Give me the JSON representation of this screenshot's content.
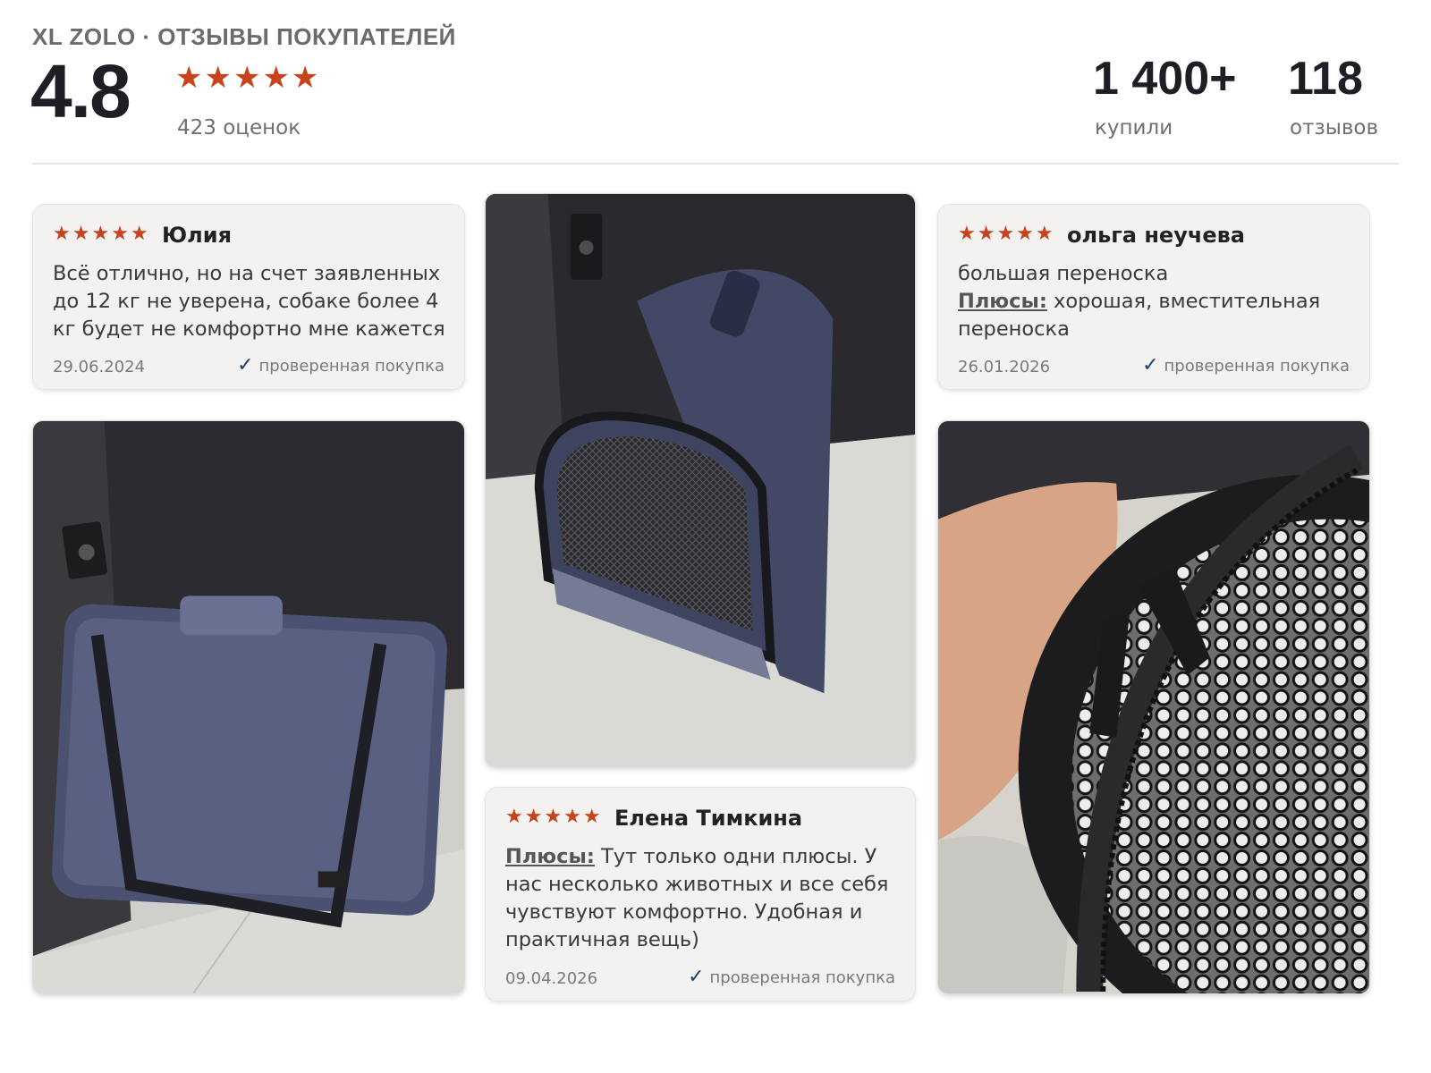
{
  "header": {
    "brand": "XL ZOLO · ОТЗЫВЫ ПОКУПАТЕЛЕЙ",
    "rating": "4.8",
    "stars": "★★★★★",
    "rating_count": "423 оценок",
    "bought_value": "1 400+",
    "bought_label": "купили",
    "reviews_value": "118",
    "reviews_label": "отзывов"
  },
  "reviews": [
    {
      "stars": "★★★★★",
      "author": "Юлия",
      "text": "Всё отлично, но на счет заявленных до 12 кг не уверена, собаке более 4 кг будет не комфортно мне кажется",
      "date": "29.06.2024",
      "verified": "проверенная покупка"
    },
    {
      "stars": "★★★★★",
      "author": "ольга неучева",
      "text": "большая переноска",
      "pros_label": "Плюсы:",
      "pros_text": "хорошая, вместительная переноска",
      "date": "26.01.2026",
      "verified": "проверенная покупка"
    },
    {
      "stars": "★★★★★",
      "author": "Елена Тимкина",
      "pros_label": "Плюсы:",
      "pros_text": "Тут только одни плюсы. У нас несколько животных и все себя чувствуют комфортно. Удобная и практичная вещь)",
      "date": "09.04.2026",
      "verified": "проверенная покупка"
    }
  ],
  "icons": {
    "star": "star-icon",
    "check": "checkmark-icon"
  },
  "colors": {
    "star": "#c8421b",
    "check": "#1f3f6d",
    "bag": "#4b5170"
  }
}
